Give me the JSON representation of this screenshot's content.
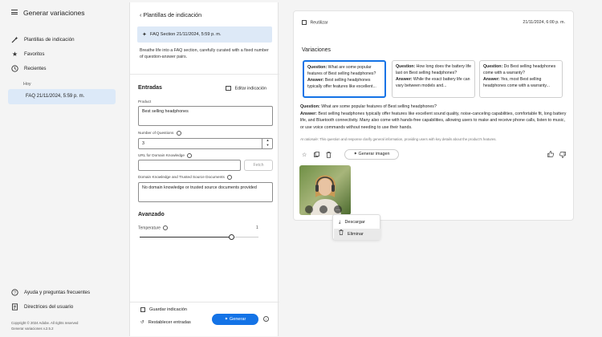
{
  "app": {
    "title": "Generar variaciones"
  },
  "nav": {
    "items": [
      {
        "label": "Plantillas de indicación",
        "icon": "magic-wand-icon"
      },
      {
        "label": "Favoritos",
        "icon": "star-icon"
      },
      {
        "label": "Recientes",
        "icon": "clock-icon"
      }
    ],
    "section_today": "Hoy",
    "selected_recent": "FAQ 21/11/2024, 5:59 p. m.",
    "help": "Ayuda y preguntas frecuentes",
    "guidelines": "Directrices del usuario",
    "copyright": "Copyright © 2024 Adobe. All rights reserved",
    "version": "Generar variaciones v.2.5.2"
  },
  "panel": {
    "back_label": "Plantillas de indicación",
    "template_name": "FAQ Section 21/11/2024, 5:59 p. m.",
    "description": "Breathe life into a FAQ section, carefully curated with a fixed number of question-answer pairs.",
    "inputs_heading": "Entradas",
    "edit_prompt": "Editar indicación",
    "fields": {
      "product_label": "Product",
      "product_value": "Best selling headphones",
      "num_questions_label": "Number of Questions",
      "num_questions_value": "3",
      "url_label": "URL for Domain Knowledge",
      "url_value": "",
      "fetch_label": "Fetch",
      "knowledge_label": "Domain Knowledge and Trusted Source Documents",
      "knowledge_value": "No domain knowledge or trusted source documents provided"
    },
    "advanced_heading": "Avanzado",
    "temperature_label": "Temperature",
    "temperature_value": "1",
    "temperature_fraction": 0.77,
    "save_prompt": "Guardar indicación",
    "reset_inputs": "Restablecer entradas",
    "generate": "Generar"
  },
  "result": {
    "reuse": "Reutilizar",
    "date": "21/11/2024, 6:00 p. m.",
    "variations_heading": "Variaciones",
    "variations": [
      {
        "q": "What are some popular features of Best selling headphones?",
        "a": "Best selling headphones typically offer features like excellent..."
      },
      {
        "q": "How long does the battery life last on Best selling headphones?",
        "a": "While the exact battery life can vary between models and..."
      },
      {
        "q": "Do Best selling headphones come with a warranty?",
        "a": "Yes, most Best selling headphones come with a warranty..."
      }
    ],
    "question_prefix": "Question:",
    "answer_prefix": "Answer:",
    "full_question": "What are some popular features of Best selling headphones?",
    "full_answer": "Best selling headphones typically offer features like excellent sound quality, noise-canceling capabilities, comfortable fit, long battery life, and Bluetooth connectivity. Many also come with hands-free capabilities, allowing users to make and receive phone calls, listen to music, or use voice commands without needing to use their hands.",
    "rationale_prefix": "AI rationale:",
    "rationale": "This question and response clarify general information, providing users with key details about the product's features.",
    "generate_image": "Generar imagen",
    "menu": {
      "download": "Descargar",
      "delete": "Eliminar"
    }
  }
}
